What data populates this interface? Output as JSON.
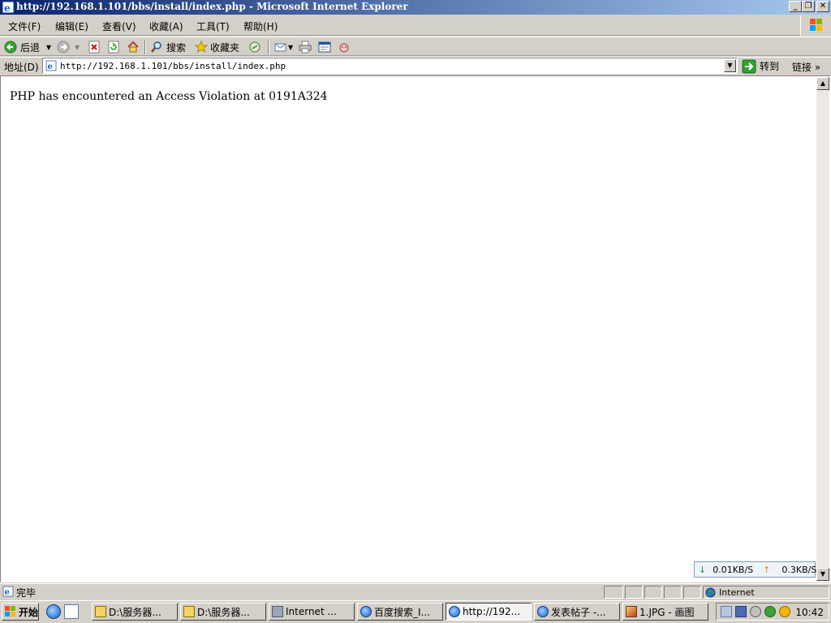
{
  "window": {
    "title": "http://192.168.1.101/bbs/install/index.php - Microsoft Internet Explorer",
    "controls": [
      "_",
      "❐",
      "✕"
    ]
  },
  "menu": {
    "items": [
      "文件(F)",
      "编辑(E)",
      "查看(V)",
      "收藏(A)",
      "工具(T)",
      "帮助(H)"
    ]
  },
  "toolbar": {
    "back_label": "后退",
    "search_label": "搜索",
    "favorites_label": "收藏夹"
  },
  "address": {
    "label": "地址(D)",
    "url": "http://192.168.1.101/bbs/install/index.php",
    "go_label": "转到",
    "links_label": "链接 »"
  },
  "content": {
    "message": "PHP has encountered an Access Violation at 0191A324"
  },
  "speed_meter": {
    "down": "0.01KB/S",
    "up": "0.3KB/S"
  },
  "status": {
    "text": "完毕",
    "zone": "Internet"
  },
  "taskbar": {
    "start_label": "开始",
    "tasks": [
      {
        "label": "D:\\服务器...",
        "icon": "folder-icon"
      },
      {
        "label": "D:\\服务器...",
        "icon": "folder-icon"
      },
      {
        "label": "Internet ...",
        "icon": "iis-icon"
      },
      {
        "label": "百度搜索_I...",
        "icon": "ie-icon"
      },
      {
        "label": "http://192...",
        "icon": "ie-icon"
      },
      {
        "label": "发表帖子 -...",
        "icon": "ie-icon"
      },
      {
        "label": "1.JPG - 画图",
        "icon": "paint-icon"
      }
    ],
    "clock": "10:42"
  },
  "colors": {
    "titlebar_start": "#0a246a",
    "titlebar_end": "#a6caf0",
    "chrome": "#d4d0c8"
  }
}
